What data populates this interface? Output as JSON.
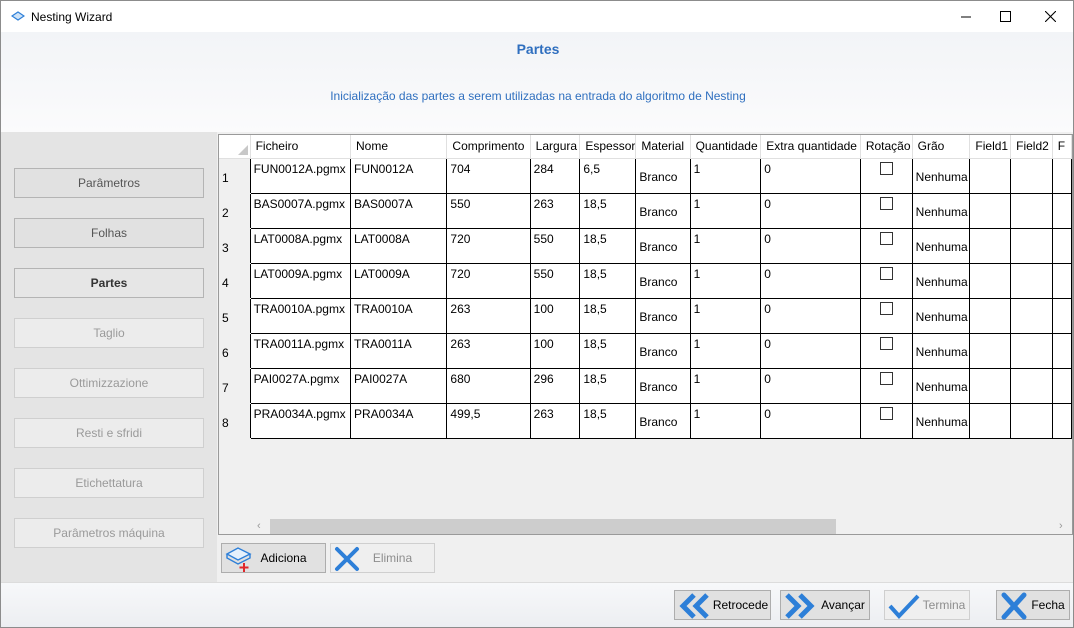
{
  "window": {
    "title": "Nesting Wizard"
  },
  "header": {
    "title": "Partes",
    "subtitle": "Inicialização das partes a serem utilizadas na entrada do algoritmo de Nesting"
  },
  "sidebar": {
    "items": [
      {
        "label": "Parâmetros",
        "state": "normal"
      },
      {
        "label": "Folhas",
        "state": "normal"
      },
      {
        "label": "Partes",
        "state": "active"
      },
      {
        "label": "Taglio",
        "state": "disabled"
      },
      {
        "label": "Ottimizzazione",
        "state": "disabled"
      },
      {
        "label": "Resti e sfridi",
        "state": "disabled"
      },
      {
        "label": "Etichettatura",
        "state": "disabled"
      },
      {
        "label": "Parâmetros máquina",
        "state": "disabled"
      }
    ]
  },
  "grid": {
    "columns": [
      "Ficheiro",
      "Nome",
      "Comprimento",
      "Largura",
      "Espessor",
      "Material",
      "Quantidade",
      "Extra quantidade",
      "Rotação",
      "Grão",
      "Field1",
      "Field2",
      "F"
    ],
    "rows": [
      {
        "num": "1",
        "file": "FUN0012A.pgmx",
        "name": "FUN0012A",
        "length": "704",
        "width": "284",
        "thickness": "6,5",
        "material": "Branco",
        "qty": "1",
        "extra": "0",
        "rotation": false,
        "grain": "Nenhuma"
      },
      {
        "num": "2",
        "file": "BAS0007A.pgmx",
        "name": "BAS0007A",
        "length": "550",
        "width": "263",
        "thickness": "18,5",
        "material": "Branco",
        "qty": "1",
        "extra": "0",
        "rotation": false,
        "grain": "Nenhuma"
      },
      {
        "num": "3",
        "file": "LAT0008A.pgmx",
        "name": "LAT0008A",
        "length": "720",
        "width": "550",
        "thickness": "18,5",
        "material": "Branco",
        "qty": "1",
        "extra": "0",
        "rotation": false,
        "grain": "Nenhuma"
      },
      {
        "num": "4",
        "file": "LAT0009A.pgmx",
        "name": "LAT0009A",
        "length": "720",
        "width": "550",
        "thickness": "18,5",
        "material": "Branco",
        "qty": "1",
        "extra": "0",
        "rotation": false,
        "grain": "Nenhuma"
      },
      {
        "num": "5",
        "file": "TRA0010A.pgmx",
        "name": "TRA0010A",
        "length": "263",
        "width": "100",
        "thickness": "18,5",
        "material": "Branco",
        "qty": "1",
        "extra": "0",
        "rotation": false,
        "grain": "Nenhuma"
      },
      {
        "num": "6",
        "file": "TRA0011A.pgmx",
        "name": "TRA0011A",
        "length": "263",
        "width": "100",
        "thickness": "18,5",
        "material": "Branco",
        "qty": "1",
        "extra": "0",
        "rotation": false,
        "grain": "Nenhuma"
      },
      {
        "num": "7",
        "file": "PAI0027A.pgmx",
        "name": "PAI0027A",
        "length": "680",
        "width": "296",
        "thickness": "18,5",
        "material": "Branco",
        "qty": "1",
        "extra": "0",
        "rotation": false,
        "grain": "Nenhuma"
      },
      {
        "num": "8",
        "file": "PRA0034A.pgmx",
        "name": "PRA0034A",
        "length": "499,5",
        "width": "263",
        "thickness": "18,5",
        "material": "Branco",
        "qty": "1",
        "extra": "0",
        "rotation": false,
        "grain": "Nenhuma"
      }
    ]
  },
  "grid_actions": {
    "add_label": "Adiciona",
    "remove_label": "Elimina"
  },
  "footer": {
    "back_label": "Retrocede",
    "next_label": "Avançar",
    "finish_label": "Termina",
    "close_label": "Fecha"
  },
  "icons": {
    "app": "nesting-app-icon",
    "add": "add-part-icon",
    "remove": "x-mark-icon",
    "back": "double-chevron-left-icon",
    "next": "double-chevron-right-icon",
    "finish": "checkmark-icon",
    "close": "x-mark-icon"
  },
  "colors": {
    "accent": "#2f6fbf",
    "icon_blue": "#2d7fd8",
    "add_plus": "#e0272b"
  }
}
